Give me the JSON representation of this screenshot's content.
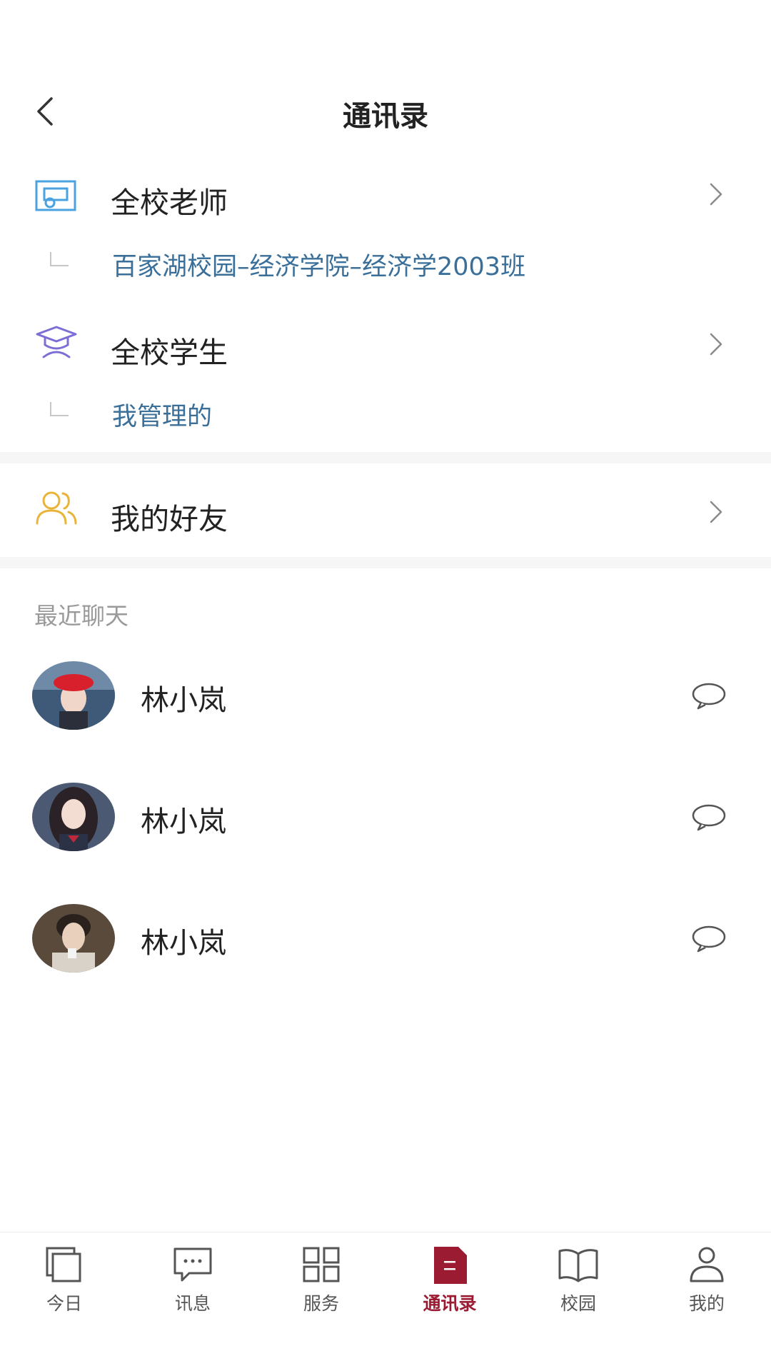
{
  "header": {
    "title": "通讯录"
  },
  "sections": {
    "teachers": {
      "label": "全校老师",
      "sub_label": "百家湖校园–经济学院–经济学2003班"
    },
    "students": {
      "label": "全校学生",
      "sub_label": "我管理的"
    },
    "friends": {
      "label": "我的好友"
    }
  },
  "recent": {
    "title": "最近聊天",
    "items": [
      {
        "name": "林小岚"
      },
      {
        "name": "林小岚"
      },
      {
        "name": "林小岚"
      }
    ]
  },
  "bottom_nav": {
    "items": [
      {
        "label": "今日",
        "icon": "copy-icon"
      },
      {
        "label": "讯息",
        "icon": "message-icon"
      },
      {
        "label": "服务",
        "icon": "grid-icon"
      },
      {
        "label": "通讯录",
        "icon": "contacts-book-icon",
        "active": true
      },
      {
        "label": "校园",
        "icon": "book-icon"
      },
      {
        "label": "我的",
        "icon": "user-icon"
      }
    ]
  },
  "colors": {
    "accent": "#9b1b33",
    "teacher_icon": "#4aa3e0",
    "student_icon": "#7b6fd6",
    "friends_icon": "#e8b53a",
    "sub_label": "#3a6f9a"
  }
}
